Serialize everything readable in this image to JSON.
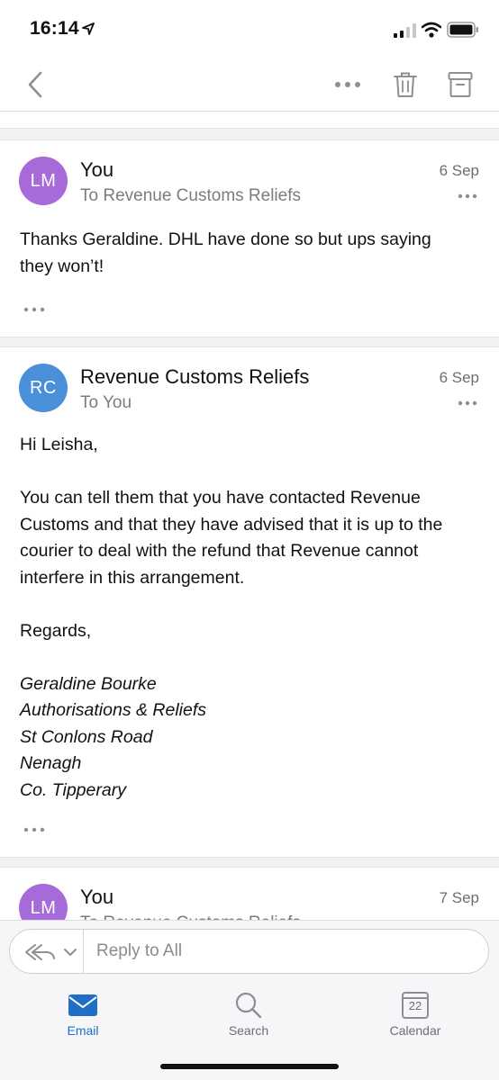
{
  "status_bar": {
    "time": "16:14"
  },
  "messages": [
    {
      "avatar": "LM",
      "avatar_color": "#a66bd8",
      "sender": "You",
      "recipient": "To Revenue Customs Reliefs",
      "date": "6 Sep",
      "body": [
        "Thanks Geraldine. DHL have done so but ups saying",
        "they won’t!"
      ]
    },
    {
      "avatar": "RC",
      "avatar_color": "#4a90d9",
      "sender": "Revenue Customs Reliefs",
      "recipient": "To You",
      "date": "6 Sep",
      "greeting": "Hi Leisha,",
      "body": [
        "You can tell them that you have contacted Revenue",
        "Customs and that they have advised that it is up to the",
        "courier to deal with the refund that Revenue cannot",
        "interfere in this arrangement."
      ],
      "closing": "Regards,",
      "signature": [
        "Geraldine Bourke",
        "Authorisations & Reliefs",
        "St Conlons Road",
        "Nenagh",
        "Co. Tipperary"
      ]
    },
    {
      "avatar": "LM",
      "avatar_color": "#a66bd8",
      "sender": "You",
      "recipient": "To Revenue Customs Reliefs",
      "date": "7 Sep"
    }
  ],
  "reply": {
    "placeholder": "Reply to All"
  },
  "tabs": [
    {
      "label": "Email",
      "icon": "mail-icon",
      "active": true
    },
    {
      "label": "Search",
      "icon": "search-icon",
      "active": false
    },
    {
      "label": "Calendar",
      "icon": "calendar-icon",
      "active": false,
      "badge": "22"
    }
  ],
  "colors": {
    "accent": "#1f6fc7"
  }
}
